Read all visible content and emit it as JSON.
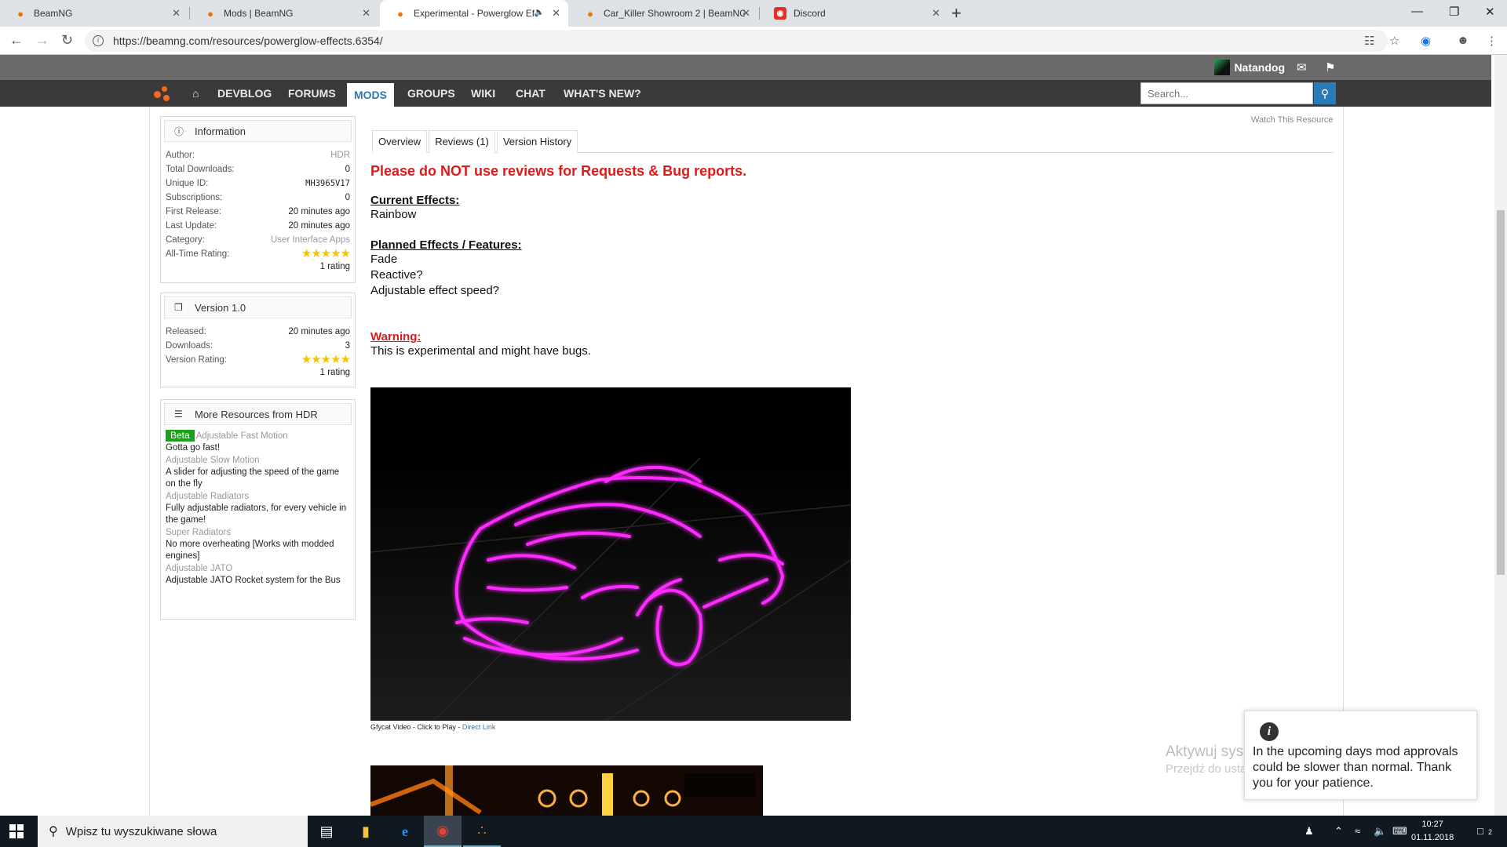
{
  "browser": {
    "tabs": [
      {
        "title": "BeamNG",
        "favicon": "beamng-icon"
      },
      {
        "title": "Mods | BeamNG",
        "favicon": "beamng-icon"
      },
      {
        "title": "Experimental - Powerglow Ef",
        "favicon": "beamng-icon",
        "active": true,
        "audio": true
      },
      {
        "title": "Car_Killer Showroom 2 | BeamNG",
        "favicon": "beamng-icon"
      },
      {
        "title": "Discord",
        "favicon": "discord-icon"
      }
    ],
    "url": "https://beamng.com/resources/powerglow-effects.6354/"
  },
  "site": {
    "username": "Natandog",
    "nav": [
      "DEVBLOG",
      "FORUMS",
      "MODS",
      "GROUPS",
      "WIKI",
      "CHAT",
      "WHAT'S NEW?"
    ],
    "active_nav": "MODS",
    "search_placeholder": "Search...",
    "watch_label": "Watch This Resource"
  },
  "info": {
    "heading": "Information",
    "rows": [
      {
        "k": "Author:",
        "v": "HDR"
      },
      {
        "k": "Total Downloads:",
        "v": "0"
      },
      {
        "k": "Unique ID:",
        "v": "MH3965V17"
      },
      {
        "k": "Subscriptions:",
        "v": "0"
      },
      {
        "k": "First Release:",
        "v": "20 minutes ago"
      },
      {
        "k": "Last Update:",
        "v": "20 minutes ago"
      },
      {
        "k": "Category:",
        "v": "User Interface Apps"
      }
    ],
    "rating_label": "All-Time Rating:",
    "rating_stars": 5,
    "rating_count": "1 rating"
  },
  "version": {
    "heading": "Version 1.0",
    "rows": [
      {
        "k": "Released:",
        "v": "20 minutes ago"
      },
      {
        "k": "Downloads:",
        "v": "3"
      }
    ],
    "rating_label": "Version Rating:",
    "rating_stars": 5,
    "rating_count": "1 rating"
  },
  "more": {
    "heading": "More Resources from HDR",
    "items": [
      {
        "badge": "Beta",
        "title": "Adjustable Fast Motion",
        "desc": "Gotta go fast!"
      },
      {
        "title": "Adjustable Slow Motion",
        "desc": "A slider for adjusting the speed of the game on the fly"
      },
      {
        "title": "Adjustable Radiators",
        "desc": "Fully adjustable radiators, for every vehicle in the game!"
      },
      {
        "title": "Super Radiators",
        "desc": "No more overheating [Works with modded engines]"
      },
      {
        "title": "Adjustable JATO",
        "desc": "Adjustable JATO Rocket system for the Bus"
      }
    ]
  },
  "resource_tabs": [
    "Overview",
    "Reviews (1)",
    "Version History"
  ],
  "overview": {
    "alert": "Please do NOT use reviews for Requests & Bug reports.",
    "current_title": "Current Effects:",
    "current_items": [
      "Rainbow"
    ],
    "planned_title": "Planned Effects / Features:",
    "planned_items": [
      "Fade",
      "Reactive?",
      "Adjustable effect speed?"
    ],
    "warning_title": "Warning:",
    "warning_text": "This is experimental and might have bugs.",
    "caption": "Gfycat Video - Click to Play - ",
    "caption_link": "Direct Link"
  },
  "notification": {
    "text": "In the upcoming days mod approvals could be slower than normal. Thank you for your patience."
  },
  "windows": {
    "watermark_title": "Aktywuj system Windows",
    "watermark_sub": "Przejdź do ustawień, aby aktywować system Windows.",
    "search_placeholder": "Wpisz tu wyszukiwane słowa",
    "time": "10:27",
    "date": "01.11.2018",
    "notifications": "2"
  },
  "colors": {
    "accent_blue": "#2a7ab8",
    "alert_red": "#e01a1a",
    "beamng_orange": "#f26a21",
    "beta_green": "#1aa31a",
    "glow_magenta": "#ff1aff"
  }
}
